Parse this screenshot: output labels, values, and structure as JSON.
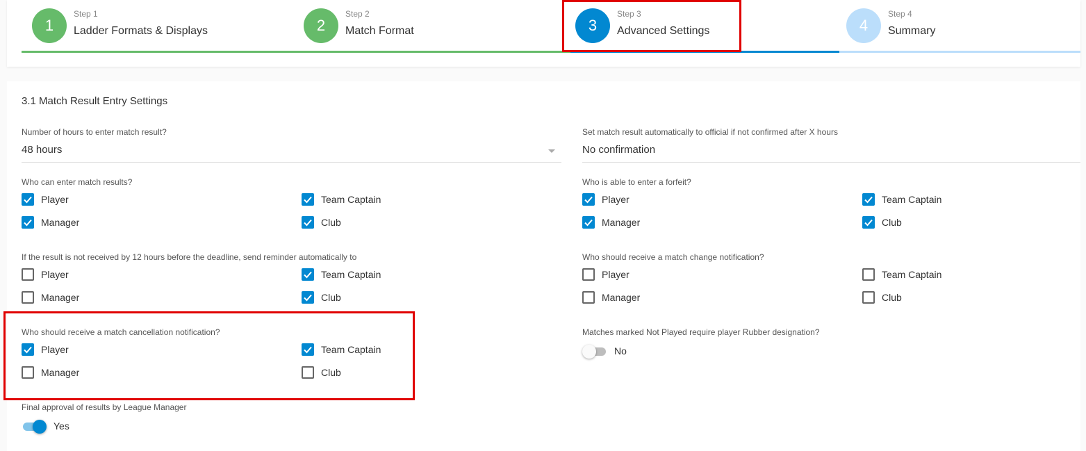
{
  "stepper": {
    "steps": [
      {
        "number": "1",
        "sublabel": "Step 1",
        "label": "Ladder Formats & Displays"
      },
      {
        "number": "2",
        "sublabel": "Step 2",
        "label": "Match Format"
      },
      {
        "number": "3",
        "sublabel": "Step 3",
        "label": "Advanced Settings"
      },
      {
        "number": "4",
        "sublabel": "Step 4",
        "label": "Summary"
      }
    ],
    "colors": {
      "done": "#66bb6a",
      "active": "#0288d1",
      "todo": "#bbdefb"
    }
  },
  "section": {
    "title": "3.1 Match Result Entry Settings"
  },
  "hours_field": {
    "label": "Number of hours to enter match result?",
    "value": "48 hours"
  },
  "auto_official_field": {
    "label": "Set match result automatically to official if not confirmed after X hours",
    "value": "No confirmation"
  },
  "enter_results": {
    "label": "Who can enter match results?",
    "options": [
      {
        "label": "Player",
        "checked": true
      },
      {
        "label": "Team Captain",
        "checked": true
      },
      {
        "label": "Manager",
        "checked": true
      },
      {
        "label": "Club",
        "checked": true
      }
    ]
  },
  "forfeit": {
    "label": "Who is able to enter a forfeit?",
    "options": [
      {
        "label": "Player",
        "checked": true
      },
      {
        "label": "Team Captain",
        "checked": true
      },
      {
        "label": "Manager",
        "checked": true
      },
      {
        "label": "Club",
        "checked": true
      }
    ]
  },
  "reminder": {
    "label": "If the result is not received by 12 hours before the deadline, send reminder automatically to",
    "options": [
      {
        "label": "Player",
        "checked": false
      },
      {
        "label": "Team Captain",
        "checked": true
      },
      {
        "label": "Manager",
        "checked": false
      },
      {
        "label": "Club",
        "checked": true
      }
    ]
  },
  "change_notification": {
    "label": "Who should receive a match change notification?",
    "options": [
      {
        "label": "Player",
        "checked": false
      },
      {
        "label": "Team Captain",
        "checked": false
      },
      {
        "label": "Manager",
        "checked": false
      },
      {
        "label": "Club",
        "checked": false
      }
    ]
  },
  "cancellation_notification": {
    "label": "Who should receive a match cancellation notification?",
    "options": [
      {
        "label": "Player",
        "checked": true
      },
      {
        "label": "Team Captain",
        "checked": true
      },
      {
        "label": "Manager",
        "checked": false
      },
      {
        "label": "Club",
        "checked": false
      }
    ]
  },
  "not_played": {
    "label": "Matches marked Not Played require player Rubber designation?",
    "value_text": "No",
    "on": false
  },
  "final_approval": {
    "label": "Final approval of results by League Manager",
    "value_text": "Yes",
    "on": true
  },
  "accent_color": "#0288d1",
  "highlight_color": "#e00000"
}
